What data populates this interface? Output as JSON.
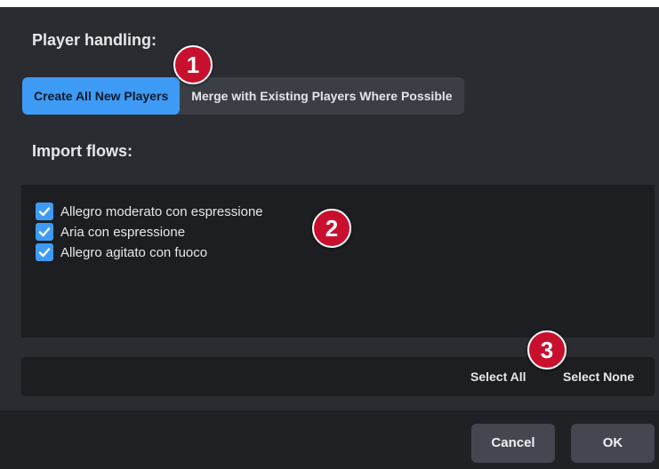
{
  "player_handling": {
    "label": "Player handling:",
    "options": [
      "Create All New Players",
      "Merge with Existing Players Where Possible"
    ],
    "selected_index": 0
  },
  "import_flows": {
    "label": "Import flows:",
    "items": [
      {
        "label": "Allegro moderato con espressione",
        "checked": true
      },
      {
        "label": "Aria con espressione",
        "checked": true
      },
      {
        "label": "Allegro agitato con fuoco",
        "checked": true
      }
    ]
  },
  "selection": {
    "select_all": "Select All",
    "select_none": "Select None"
  },
  "footer": {
    "cancel": "Cancel",
    "ok": "OK"
  },
  "callouts": [
    "1",
    "2",
    "3"
  ],
  "colors": {
    "accent": "#3e9bf5",
    "callout": "#c8102e"
  }
}
